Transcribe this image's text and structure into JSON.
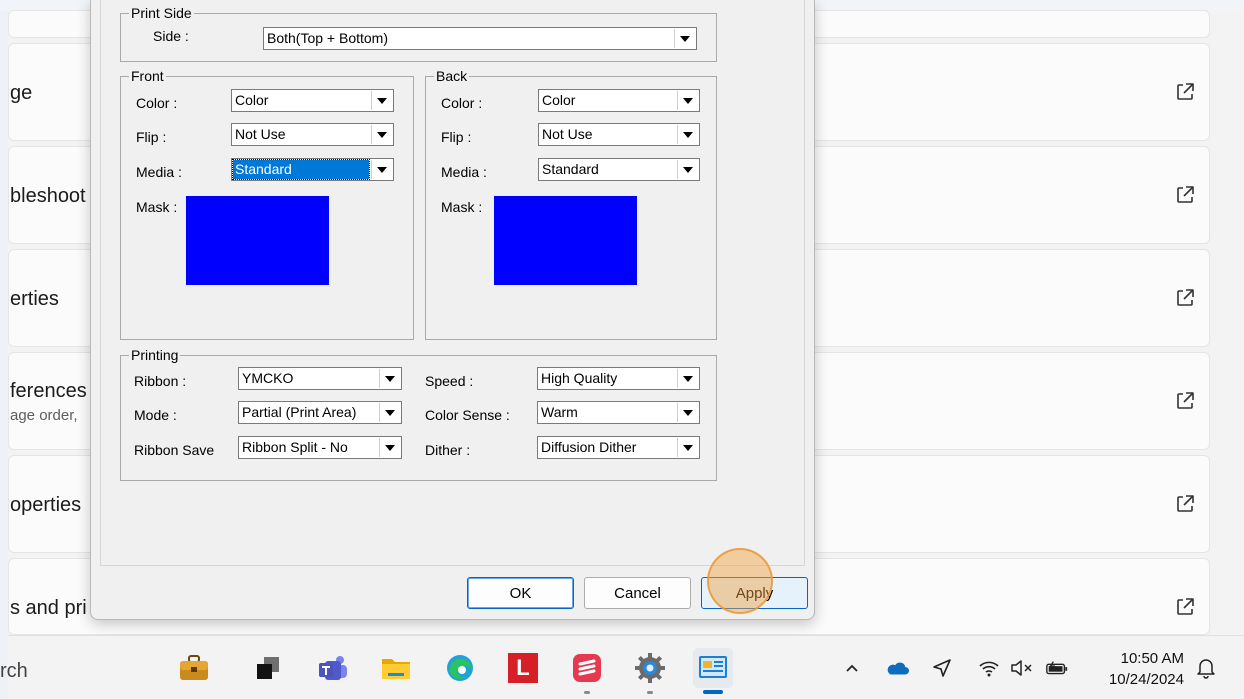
{
  "background_page": {
    "items": [
      {
        "label": "ge"
      },
      {
        "label": "bleshoot"
      },
      {
        "label": "erties"
      },
      {
        "label": "ferences",
        "sublabel": "age order,"
      },
      {
        "label": "operties"
      },
      {
        "label": "s and pri"
      }
    ]
  },
  "dialog": {
    "print_side": {
      "group_title": "Print Side",
      "side_label": "Side :",
      "side_value": "Both(Top + Bottom)"
    },
    "front": {
      "group_title": "Front",
      "color_label": "Color :",
      "color_value": "Color",
      "flip_label": "Flip :",
      "flip_value": "Not Use",
      "media_label": "Media :",
      "media_value": "Standard",
      "mask_label": "Mask :",
      "mask_color": "#0000ff"
    },
    "back": {
      "group_title": "Back",
      "color_label": "Color :",
      "color_value": "Color",
      "flip_label": "Flip :",
      "flip_value": "Not Use",
      "media_label": "Media :",
      "media_value": "Standard",
      "mask_label": "Mask :",
      "mask_color": "#0000ff"
    },
    "printing": {
      "group_title": "Printing",
      "ribbon_label": "Ribbon :",
      "ribbon_value": "YMCKO",
      "mode_label": "Mode :",
      "mode_value": "Partial (Print Area)",
      "ribbon_save_label": "Ribbon Save",
      "ribbon_save_value": "Ribbon Split - No",
      "speed_label": "Speed :",
      "speed_value": "High Quality",
      "color_sense_label": "Color Sense :",
      "color_sense_value": "Warm",
      "dither_label": "Dither :",
      "dither_value": "Diffusion Dither"
    },
    "buttons": {
      "ok": "OK",
      "cancel": "Cancel",
      "apply": "Apply"
    }
  },
  "taskbar": {
    "search_text": "rch",
    "apps": [
      {
        "icon": "briefcase-icon"
      },
      {
        "icon": "task-view-icon"
      },
      {
        "icon": "teams-icon"
      },
      {
        "icon": "file-explorer-icon"
      },
      {
        "icon": "edge-icon"
      },
      {
        "icon": "l-app-icon",
        "letter": "L"
      },
      {
        "icon": "notes-app-icon"
      },
      {
        "icon": "settings-icon"
      },
      {
        "icon": "printer-driver-icon"
      }
    ],
    "tray_icons": [
      "chevron-up-icon",
      "onedrive-icon",
      "location-icon",
      "wifi-icon",
      "volume-muted-icon",
      "battery-icon"
    ],
    "time": "10:50 AM",
    "date": "10/24/2024",
    "colors": {
      "accent": "#0067c0",
      "selection": "#0078d7"
    }
  }
}
